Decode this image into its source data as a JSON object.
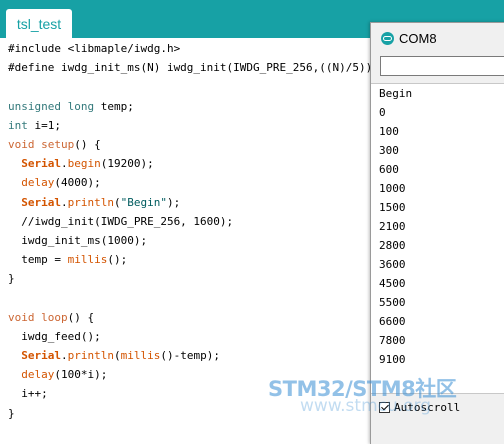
{
  "editor": {
    "tab_label": "tsl_test",
    "code_lines": [
      "#include <libmaple/iwdg.h>",
      "#define iwdg_init_ms(N) iwdg_init(IWDG_PRE_256,((N)/5))",
      "",
      "unsigned long temp;",
      "int i=1;",
      "void setup() {",
      "  Serial.begin(19200);",
      "  delay(4000);",
      "  Serial.println(\"Begin\");",
      "  //iwdg_init(IWDG_PRE_256, 1600);",
      "  iwdg_init_ms(1000);",
      "  temp = millis();",
      "}",
      "",
      "void loop() {",
      "  iwdg_feed();",
      "  Serial.println(millis()-temp);",
      "  delay(100*i);",
      "  i++;",
      "}"
    ]
  },
  "serial_monitor": {
    "title": "COM8",
    "input_value": "",
    "output_lines": [
      "Begin",
      "0",
      "100",
      "300",
      "600",
      "1000",
      "1500",
      "2100",
      "2800",
      "3600",
      "4500",
      "5500",
      "6600",
      "7800",
      "9100"
    ],
    "autoscroll_label": "Autoscroll",
    "autoscroll_checked": true
  },
  "watermark": {
    "text": "STM32/STM8社区",
    "url": "www.stmcu.org"
  },
  "colors": {
    "ide_teal": "#17a1a5",
    "keyword": "#cc6633",
    "type": "#33797b",
    "function": "#d35400",
    "string": "#005c5f"
  }
}
